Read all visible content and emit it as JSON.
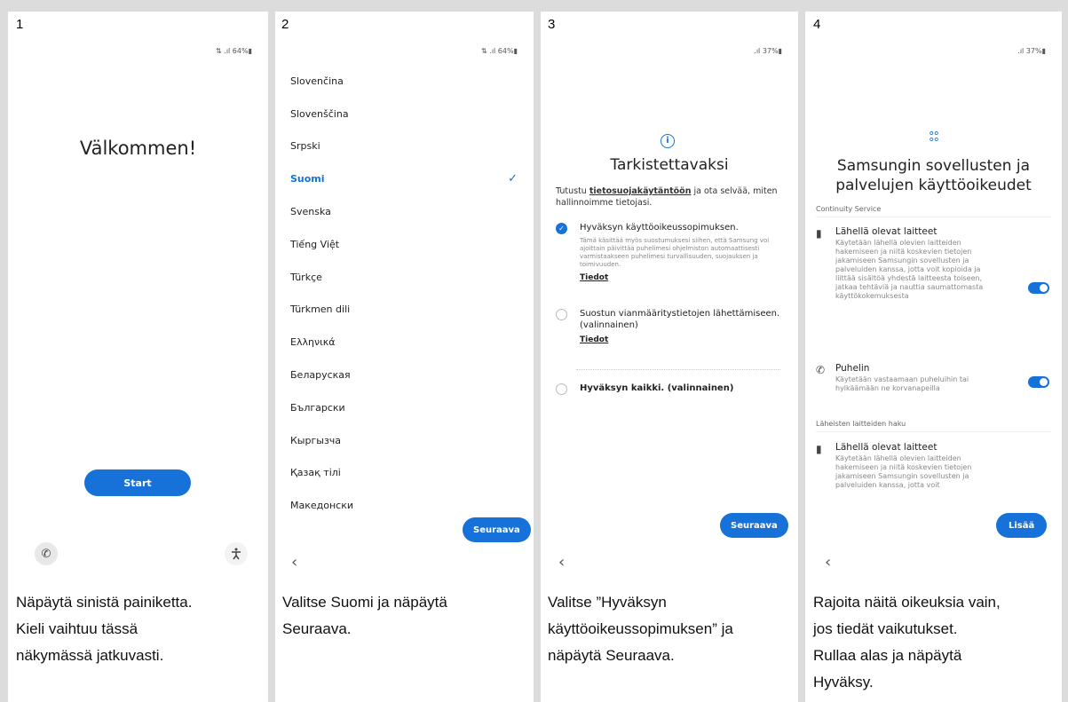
{
  "panels": [
    {
      "number": "1",
      "status": "⇅ .ıl 64%▮",
      "welcome": "Välkommen!",
      "start_label": "Start",
      "caption": [
        "Näpäytä sinistä painiketta.",
        "Kieli vaihtuu tässä",
        "näkymässä jatkuvasti."
      ]
    },
    {
      "number": "2",
      "status": "⇅ .ıl 64%▮",
      "languages": [
        "Slovenčina",
        "Slovenščina",
        "Srpski",
        "Suomi",
        "Svenska",
        "Tiếng Việt",
        "Türkçe",
        "Türkmen dili",
        "Ελληνικά",
        "Беларуская",
        "Български",
        "Кыргызча",
        "Қазақ тілі",
        "Македонски"
      ],
      "selected_language": "Suomi",
      "next_label": "Seuraava",
      "caption": [
        "Valitse Suomi ja näpäytä",
        "Seuraava."
      ]
    },
    {
      "number": "3",
      "status": ".ıl 37%▮",
      "title": "Tarkistettavaksi",
      "intro_before": "Tutustu ",
      "intro_link": "tietosuojakäytäntöön",
      "intro_after": " ja ota selvää, miten hallinnoimme tietojasi.",
      "option1_title": "Hyväksyn käyttöoikeussopimuksen.",
      "option1_desc": "Tämä käsittää myös suostumuksesi siihen, että Samsung voi ajoittain päivittää puhelimesi ohjelmiston automaattisesti varmistaakseen puhelimesi turvallisuuden, suojauksen ja toimivuuden.",
      "option1_link": "Tiedot",
      "option2_title": "Suostun vianmääritystietojen lähettämiseen. (valinnainen)",
      "option2_link": "Tiedot",
      "option3_title": "Hyväksyn kaikki. (valinnainen)",
      "next_label": "Seuraava",
      "caption": [
        "Valitse ”Hyväksyn",
        "käyttöoikeussopimuksen” ja",
        "näpäytä Seuraava."
      ]
    },
    {
      "number": "4",
      "status": ".ıl 37%▮",
      "title": "Samsungin sovellusten ja palvelujen käyttöoikeudet",
      "section1": "Continuity Service",
      "perm1_title": "Lähellä olevat laitteet",
      "perm1_desc": "Käytetään lähellä olevien laitteiden hakemiseen ja niitä koskevien tietojen jakamiseen Samsungin sovellusten ja palveluiden kanssa, jotta voit kopioida ja liittää sisältöä yhdestä laitteesta toiseen, jatkaa tehtäviä ja nauttia saumattomasta käyttökokemuksesta",
      "perm2_title": "Puhelin",
      "perm2_desc": "Käytetään vastaamaan puheluihin tai hylkäämään ne korvanapeilla",
      "section2": "Läheisten laitteiden haku",
      "perm3_title": "Lähellä olevat laitteet",
      "perm3_desc": "Käytetään lähellä olevien laitteiden hakemiseen ja niitä koskevien tietojen jakamiseen Samsungin sovellusten ja palveluiden kanssa, jotta voit",
      "more_label": "Lisää",
      "caption": [
        "Rajoita näitä oikeuksia vain,",
        "jos tiedät vaikutukset.",
        "Rullaa alas ja näpäytä",
        "Hyväksy."
      ]
    }
  ],
  "colors": {
    "accent": "#1672d9",
    "background": "#dcdcdc"
  },
  "icons": [
    "phone-icon",
    "accessibility-icon",
    "check-icon",
    "info-icon",
    "apps-icon",
    "nearby-device-icon",
    "back-chevron-icon"
  ]
}
